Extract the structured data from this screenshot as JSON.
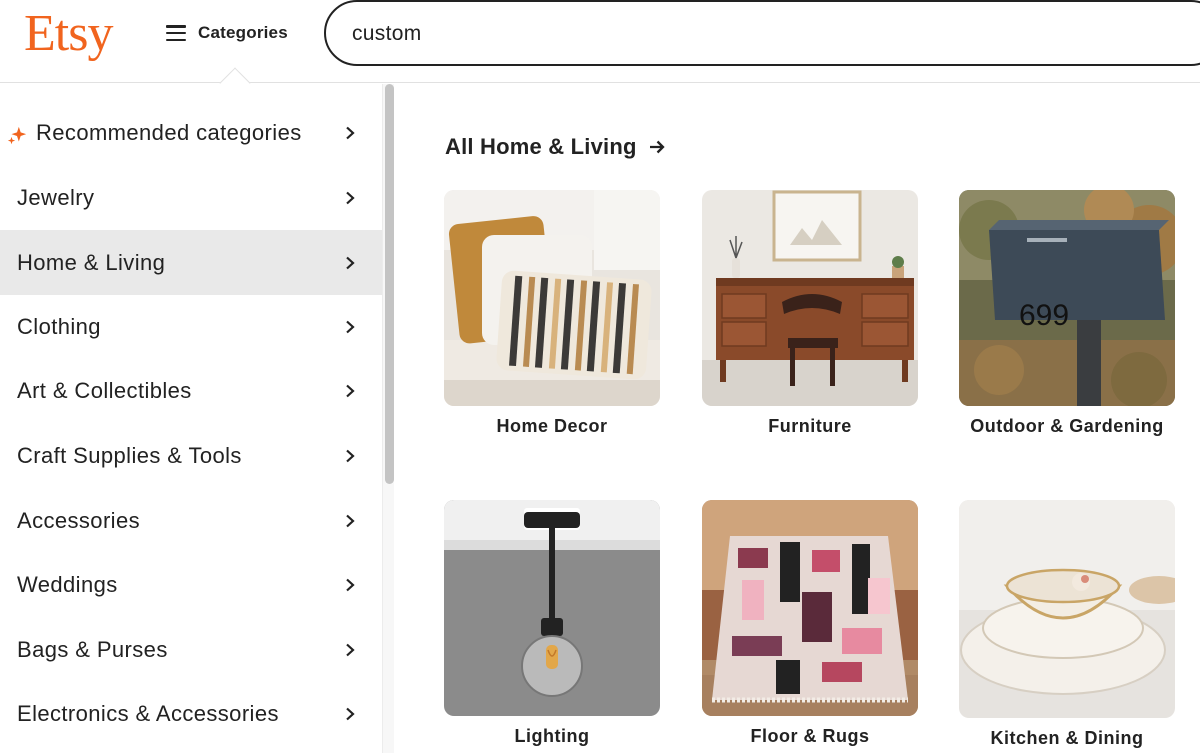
{
  "header": {
    "logo": "Etsy",
    "categories_label": "Categories",
    "search_value": "custom"
  },
  "colors": {
    "brand": "#f1641e",
    "active_row": "#e9e9e9",
    "text": "#222222"
  },
  "sidebar": {
    "items": [
      {
        "label": "Recommended categories",
        "icon": "sparkle-icon",
        "active": false
      },
      {
        "label": "Jewelry",
        "active": false
      },
      {
        "label": "Home & Living",
        "active": true
      },
      {
        "label": "Clothing",
        "active": false
      },
      {
        "label": "Art & Collectibles",
        "active": false
      },
      {
        "label": "Craft Supplies & Tools",
        "active": false
      },
      {
        "label": "Accessories",
        "active": false
      },
      {
        "label": "Weddings",
        "active": false
      },
      {
        "label": "Bags & Purses",
        "active": false
      },
      {
        "label": "Electronics & Accessories",
        "active": false
      }
    ]
  },
  "main": {
    "title": "All Home & Living",
    "cards": [
      {
        "label": "Home Decor"
      },
      {
        "label": "Furniture"
      },
      {
        "label": "Outdoor & Gardening"
      },
      {
        "label": "Lighting"
      },
      {
        "label": "Floor & Rugs"
      },
      {
        "label": "Kitchen & Dining"
      }
    ]
  }
}
